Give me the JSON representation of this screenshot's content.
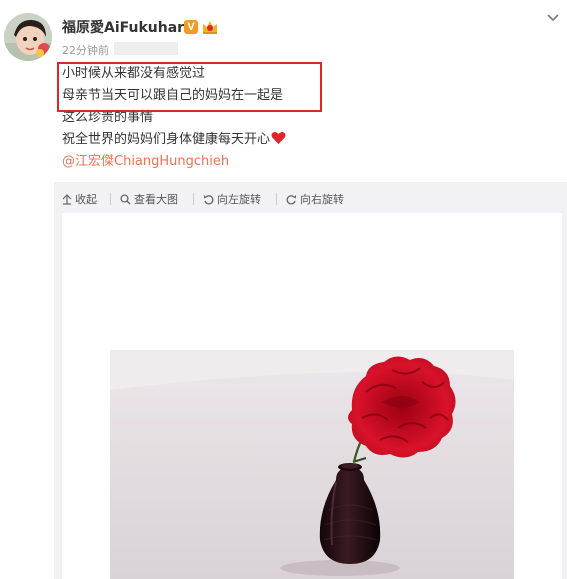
{
  "post": {
    "username": "福原愛AiFukuhara",
    "verified_badge": "V",
    "time": "22分钟前",
    "lines": [
      "小时候从来都没有感觉过",
      "母亲节当天可以跟自己的妈妈在一起是",
      "这么珍贵的事情",
      "祝全世界的妈妈们身体健康每天开心"
    ],
    "mention": "@江宏傑ChiangHungchieh",
    "icons": [
      "avatar",
      "verified-v-badge",
      "crown-badge",
      "chevron-down-icon",
      "heart-emoji"
    ]
  },
  "toolbar": {
    "collapse": "收起",
    "view_large": "查看大图",
    "rotate_left": "向左旋转",
    "rotate_right": "向右旋转",
    "icons": [
      "arrow-up-icon",
      "magnifier-icon",
      "rotate-left-icon",
      "rotate-right-icon"
    ]
  },
  "photo": {
    "subject": "red carnation in black vase"
  },
  "colors": {
    "mention": "#eb7350",
    "highlight": "#e0262a",
    "badge": "#f49a22",
    "heart": "#e0262a"
  }
}
